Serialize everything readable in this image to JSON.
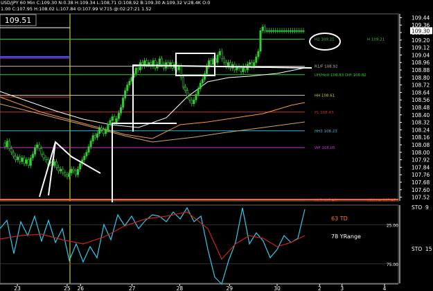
{
  "header": {
    "line1": "USD/JPY 60 Min  C:109.30  N:0.38  H:109.34  L:108.71  O:108.92  B:109.30  A:109.32  V:28.4K  O:0",
    "line2": "1.00  C:107.95  H:108.02  L:107.84  O:107.99  V:715  @:02:27:21  1.52"
  },
  "price_box": "109.51",
  "price_axis": {
    "ticks": [
      "109.44",
      "109.36",
      "109.28",
      "109.20",
      "109.12",
      "109.04",
      "108.96",
      "108.88",
      "108.80",
      "108.72",
      "108.64",
      "108.56",
      "108.48",
      "108.40",
      "108.32",
      "108.24",
      "108.16",
      "108.08",
      "108.00",
      "107.92",
      "107.84",
      "107.76",
      "107.68",
      "107.60",
      "107.52"
    ],
    "last": "109.30",
    "ylim": [
      107.48,
      109.48
    ]
  },
  "levels": [
    {
      "id": "h2",
      "label": "H2  109.21",
      "label2": "H  109.21",
      "price": 109.21,
      "color": "#33cc33"
    },
    {
      "id": "r1",
      "label": "R1/F  108.92",
      "price": 108.92,
      "color": "#bbbbbb"
    },
    {
      "id": "uh",
      "label": "UH/Hotl  108.83  Dlft  108.82",
      "price": 108.83,
      "color": "#33cc33"
    },
    {
      "id": "hh",
      "label": "HH  108.61",
      "price": 108.61,
      "color": "#cccc44"
    },
    {
      "id": "pl",
      "label": "PL  108.43",
      "price": 108.43,
      "color": "#cc3333"
    },
    {
      "id": "hh3",
      "label": "HH3  108.23",
      "price": 108.23,
      "color": "#33bbdd"
    },
    {
      "id": "wf",
      "label": "WF  108.05",
      "price": 108.05,
      "color": "#cc33cc"
    },
    {
      "id": "hl3",
      "label": "HL3  107.48",
      "label2": "LM/Low  107.47",
      "price": 107.49,
      "color": "#ff5533"
    }
  ],
  "indicator": {
    "label1": "63 TD",
    "label2": "78 YRange",
    "sto_label": "STO",
    "sto_value": "9",
    "sto_label2": "STO",
    "sto_value2": "15",
    "ticks": [
      "25.00",
      "75.00"
    ],
    "ylim": [
      100,
      0
    ]
  },
  "time_axis": {
    "labels": [
      {
        "text": "23",
        "x": 0.04
      },
      {
        "text": "25",
        "x": 0.155
      },
      {
        "text": "26",
        "x": 0.186
      },
      {
        "text": "27",
        "x": 0.305
      },
      {
        "text": "28",
        "x": 0.415
      },
      {
        "text": "29",
        "x": 0.53
      },
      {
        "text": "30",
        "x": 0.64
      },
      {
        "text": "2",
        "x": 0.738
      },
      {
        "text": "3",
        "x": 0.79
      },
      {
        "text": "4",
        "x": 0.888
      }
    ]
  },
  "chart_data": {
    "type": "line",
    "title": "USD/JPY 60 Min",
    "x": [
      0,
      1,
      2,
      3,
      4,
      5,
      6,
      7,
      8,
      9,
      10,
      11,
      12,
      13,
      14,
      15,
      16,
      17,
      18,
      19,
      20,
      21,
      22,
      23,
      24,
      25,
      26,
      27,
      28,
      29,
      30,
      31,
      32,
      33,
      34,
      35,
      36,
      37,
      38,
      39,
      40,
      41,
      42,
      43,
      44,
      45,
      46,
      47,
      48,
      49,
      50,
      51,
      52,
      53,
      54,
      55,
      56,
      57,
      58,
      59,
      60,
      61,
      62,
      63,
      64,
      65,
      66,
      67,
      68,
      69,
      70,
      71,
      72,
      73,
      74,
      75,
      76,
      77,
      78,
      79,
      80,
      81,
      82,
      83,
      84,
      85,
      86,
      87,
      88,
      89,
      90,
      91,
      92,
      93,
      94,
      95,
      96,
      97,
      98,
      99,
      100,
      101,
      102,
      103,
      104,
      105,
      106,
      107,
      108,
      109,
      110,
      111,
      112,
      113,
      114,
      115,
      116,
      117,
      118,
      119,
      120,
      121,
      122,
      123,
      124,
      125,
      126,
      127,
      128,
      129,
      130,
      131,
      132,
      133,
      134,
      135,
      136,
      137,
      138,
      139,
      140
    ],
    "series": [
      {
        "values": [
          108.1,
          108.06,
          108.12,
          108.04,
          108.0,
          107.96,
          107.92,
          107.95,
          107.9,
          107.94,
          107.88,
          107.92,
          107.86,
          107.94,
          107.98,
          108.05,
          108.08,
          108.04,
          107.98,
          107.94,
          107.92,
          107.88,
          107.9,
          107.86,
          107.9,
          107.84,
          107.8,
          107.82,
          107.78,
          107.76,
          107.74,
          107.78,
          107.82,
          107.8,
          107.76,
          107.82,
          107.88,
          107.92,
          107.96,
          108.0,
          108.06,
          108.12,
          108.18,
          108.16,
          108.2,
          108.26,
          108.24,
          108.2,
          108.24,
          108.3,
          108.34,
          108.38,
          108.32,
          108.36,
          108.42,
          108.48,
          108.58,
          108.66,
          108.72,
          108.76,
          108.8,
          108.84,
          108.9,
          108.88,
          108.96,
          108.92,
          108.98,
          108.94,
          108.96,
          108.92,
          108.98,
          108.9,
          108.94,
          109.0,
          108.94,
          108.9,
          108.96,
          108.92,
          108.96,
          108.9,
          108.94,
          108.88,
          108.92,
          108.8,
          108.7,
          108.66,
          108.6,
          108.56,
          108.52,
          108.56,
          108.62,
          108.68,
          108.74,
          108.78,
          108.84,
          108.92,
          108.98,
          108.94,
          109.0,
          108.96,
          109.04,
          109.08,
          109.0,
          108.96,
          108.92,
          108.96,
          108.9,
          108.94,
          108.88,
          108.92,
          108.9,
          108.86,
          108.92,
          108.88,
          108.94,
          108.96,
          108.92,
          108.96,
          109.02,
          109.08,
          109.3,
          109.34,
          109.3,
          109.3,
          109.3,
          109.3,
          109.3,
          109.3,
          109.3,
          109.3,
          109.3,
          109.3,
          109.3,
          109.3,
          109.3,
          109.3,
          109.3,
          109.3,
          109.3,
          109.3,
          109.3
        ]
      }
    ],
    "ylim": [
      107.48,
      109.48
    ]
  }
}
